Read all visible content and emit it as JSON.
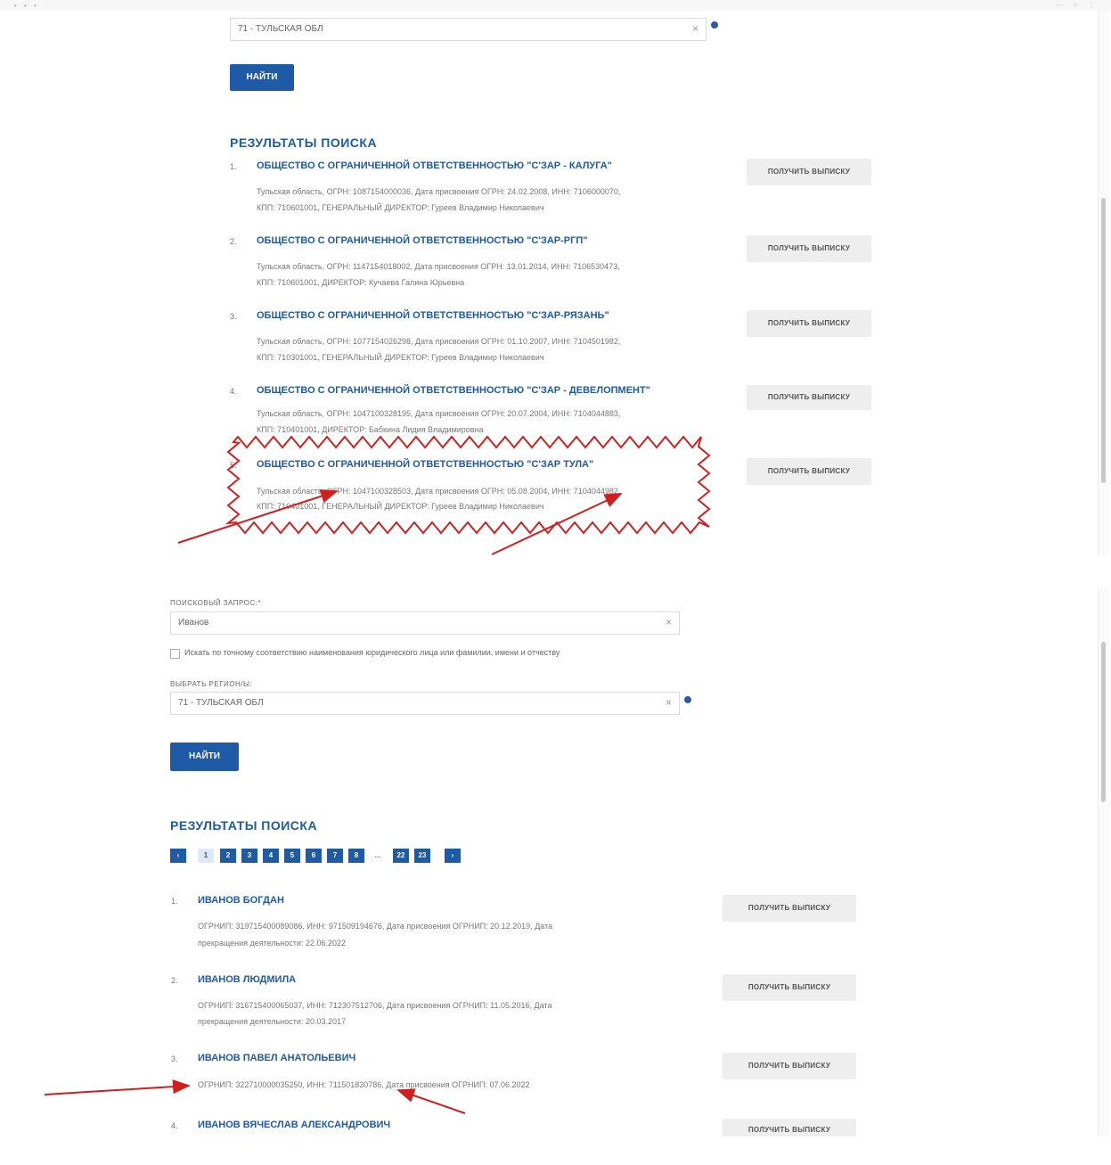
{
  "browser": {
    "dots": "• • •",
    "tools": "⋯ ☆ ⋮"
  },
  "top": {
    "region_value": "71 - ТУЛЬСКАЯ ОБЛ",
    "clear": "×",
    "find_button": "НАЙТИ",
    "results_title": "РЕЗУЛЬТАТЫ ПОИСКА",
    "results": [
      {
        "num": "1.",
        "name": "ОБЩЕСТВО С ОГРАНИЧЕННОЙ ОТВЕТСТВЕННОСТЬЮ \"С'ЗАР - КАЛУГА\"",
        "line1": "Тульская область, ОГРН: 1087154000036, Дата присвоения ОГРН: 24.02.2008, ИНН: 7106000070,",
        "line2": "КПП: 710601001, ГЕНЕРАЛЬНЫЙ ДИРЕКТОР: Гуреев Владимир Николаевич",
        "button": "ПОЛУЧИТЬ ВЫПИСКУ"
      },
      {
        "num": "2.",
        "name": "ОБЩЕСТВО С ОГРАНИЧЕННОЙ ОТВЕТСТВЕННОСТЬЮ \"С'ЗАР-РГП\"",
        "line1": "Тульская область, ОГРН: 1147154018002, Дата присвоения ОГРН: 13.01.2014, ИНН: 7106530473,",
        "line2": "КПП: 710601001, ДИРЕКТОР: Кучаева Галина Юрьевна",
        "button": "ПОЛУЧИТЬ ВЫПИСКУ"
      },
      {
        "num": "3.",
        "name": "ОБЩЕСТВО С ОГРАНИЧЕННОЙ ОТВЕТСТВЕННОСТЬЮ \"С'ЗАР-РЯЗАНЬ\"",
        "line1": "Тульская область, ОГРН: 1077154026298, Дата присвоения ОГРН: 01.10.2007, ИНН: 7104501982,",
        "line2": "КПП: 710301001, ГЕНЕРАЛЬНЫЙ ДИРЕКТОР: Гуреев Владимир Николаевич",
        "button": "ПОЛУЧИТЬ ВЫПИСКУ"
      },
      {
        "num": "4.",
        "name": "ОБЩЕСТВО С ОГРАНИЧЕННОЙ ОТВЕТСТВЕННОСТЬЮ \"С'ЗАР - ДЕВЕЛОПМЕНТ\"",
        "line1": "Тульская область, ОГРН: 1047100328195, Дата присвоения ОГРН: 20.07.2004, ИНН: 7104044883,",
        "line2": "КПП: 710401001, ДИРЕКТОР: Бабкина Лидия Владимировна",
        "button": "ПОЛУЧИТЬ ВЫПИСКУ"
      },
      {
        "num": "5.",
        "name": "ОБЩЕСТВО С ОГРАНИЧЕННОЙ ОТВЕТСТВЕННОСТЬЮ \"С'ЗАР ТУЛА\"",
        "line1": "Тульская область, ОГРН: 1047100328503, Дата присвоения ОГРН: 05.08.2004, ИНН: 7104044982,",
        "line2": "КПП: 710401001, ГЕНЕРАЛЬНЫЙ ДИРЕКТОР: Гуреев Владимир Николаевич",
        "button": "ПОЛУЧИТЬ ВЫПИСКУ"
      }
    ]
  },
  "bottom": {
    "query_label": "ПОИСКОВЫЙ ЗАПРОС:",
    "required_mark": "*",
    "query_value": "Иванов",
    "clear": "×",
    "exact_match_label": "Искать по точному соответствию наименования юридического лица или фамилии, имени и отчеству",
    "region_label": "ВЫБРАТЬ РЕГИОН/Ы:",
    "region_value": "71 - ТУЛЬСКАЯ ОБЛ",
    "find_button": "НАЙТИ",
    "results_title": "РЕЗУЛЬТАТЫ ПОИСКА",
    "pager": {
      "prev": "‹",
      "pages": [
        "1",
        "2",
        "3",
        "4",
        "5",
        "6",
        "7",
        "8"
      ],
      "ellipsis": "...",
      "last_pages": [
        "22",
        "23"
      ],
      "next": "›"
    },
    "results": [
      {
        "num": "1.",
        "name": "ИВАНОВ БОГДАН",
        "line1": "ОГРНИП: 319715400089086, ИНН: 971509194676, Дата присвоения ОГРНИП: 20.12.2019, Дата",
        "line2": "прекращения деятельности: 22.06.2022",
        "button": "ПОЛУЧИТЬ ВЫПИСКУ"
      },
      {
        "num": "2.",
        "name": "ИВАНОВ ЛЮДМИЛА",
        "line1": "ОГРНИП: 316715400065037, ИНН: 712307512706, Дата присвоения ОГРНИП: 11.05.2016, Дата",
        "line2": "прекращения деятельности: 20.03.2017",
        "button": "ПОЛУЧИТЬ ВЫПИСКУ"
      },
      {
        "num": "3.",
        "name": "ИВАНОВ ПАВЕЛ АНАТОЛЬЕВИЧ",
        "line1": "ОГРНИП: 322710000035250, ИНН: 711501830786, Дата присвоения ОГРНИП: 07.06.2022",
        "line2": "",
        "button": "ПОЛУЧИТЬ ВЫПИСКУ"
      },
      {
        "num": "4.",
        "name": "ИВАНОВ ВЯЧЕСЛАВ АЛЕКСАНДРОВИЧ",
        "line1": "",
        "line2": "",
        "button": "ПОЛУЧИТЬ ВЫПИСКУ"
      }
    ]
  },
  "colors": {
    "accent": "#1f5aa6",
    "annotation": "#d11f1f",
    "button_grey": "#eeeeee"
  }
}
